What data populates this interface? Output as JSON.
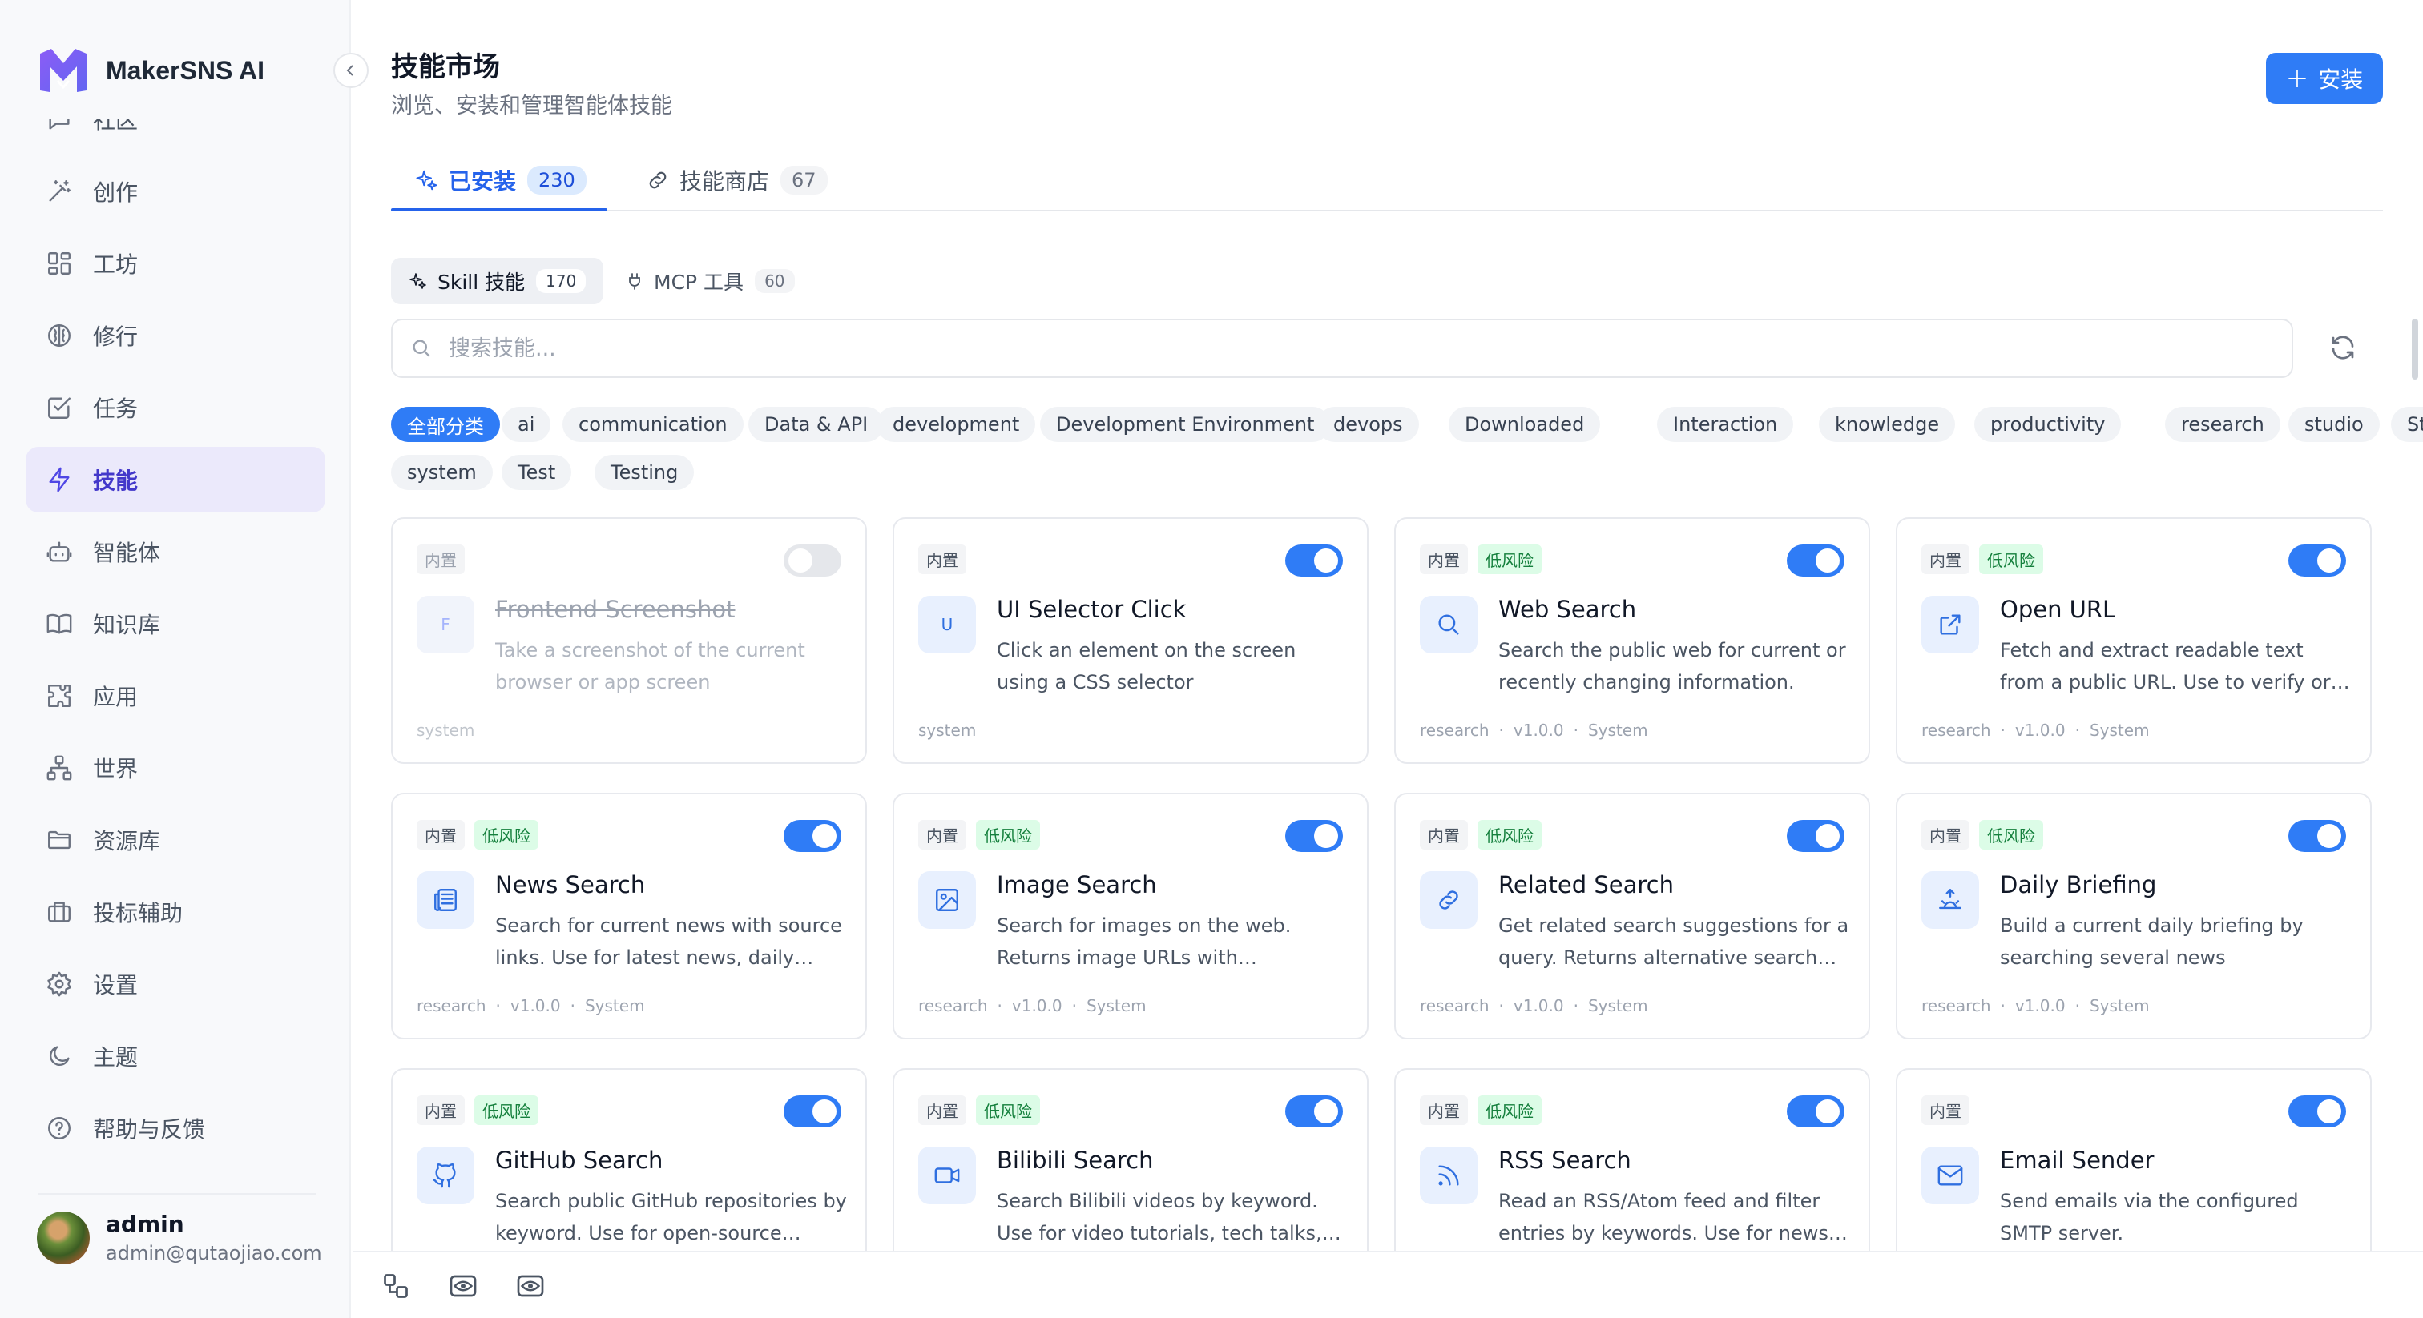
{
  "brand": {
    "name": "MakerSNS AI"
  },
  "sidebar": {
    "items": [
      {
        "label": "社区",
        "icon": "chat-icon"
      },
      {
        "label": "创作",
        "icon": "magic-wand-icon"
      },
      {
        "label": "工坊",
        "icon": "grid-icon"
      },
      {
        "label": "修行",
        "icon": "brain-icon"
      },
      {
        "label": "任务",
        "icon": "checkbox-icon"
      },
      {
        "label": "技能",
        "icon": "lightning-icon",
        "active": true
      },
      {
        "label": "智能体",
        "icon": "bot-icon"
      },
      {
        "label": "知识库",
        "icon": "book-icon"
      },
      {
        "label": "应用",
        "icon": "puzzle-icon"
      },
      {
        "label": "世界",
        "icon": "network-icon"
      },
      {
        "label": "资源库",
        "icon": "folder-icon"
      },
      {
        "label": "投标辅助",
        "icon": "briefcase-icon"
      },
      {
        "label": "设置",
        "icon": "gear-icon"
      },
      {
        "label": "主题",
        "icon": "moon-icon"
      },
      {
        "label": "帮助与反馈",
        "icon": "help-icon"
      }
    ],
    "user": {
      "name": "admin",
      "email": "admin@qutaojiao.com"
    }
  },
  "header": {
    "title": "技能市场",
    "subtitle": "浏览、安装和管理智能体技能",
    "install_label": "安装"
  },
  "tabs": [
    {
      "label": "已安装",
      "count": "230",
      "active": true
    },
    {
      "label": "技能商店",
      "count": "67",
      "active": false
    }
  ],
  "subtabs": [
    {
      "label": "Skill 技能",
      "count": "170",
      "active": true
    },
    {
      "label": "MCP 工具",
      "count": "60",
      "active": false
    }
  ],
  "search": {
    "placeholder": "搜索技能..."
  },
  "categories": [
    "全部分类",
    "ai",
    "communication",
    "Data & API",
    "development",
    "Development Environment",
    "devops",
    "Downloaded",
    "Interaction",
    "knowledge",
    "productivity",
    "research",
    "studio",
    "Studio",
    "system",
    "Test",
    "Testing"
  ],
  "labels": {
    "builtin": "内置",
    "low_risk": "低风险"
  },
  "skills": [
    {
      "title": "Frontend Screenshot",
      "desc": "Take a screenshot of the current browser or app screen",
      "category": "system",
      "version": "",
      "author": "",
      "enabled": false,
      "low_risk": false,
      "icon_letter": "F",
      "icon": "letter"
    },
    {
      "title": "UI Selector Click",
      "desc": "Click an element on the screen using a CSS selector",
      "category": "system",
      "version": "",
      "author": "",
      "enabled": true,
      "low_risk": false,
      "icon_letter": "U",
      "icon": "letter"
    },
    {
      "title": "Web Search",
      "desc": "Search the public web for current or recently changing information. Use…",
      "category": "research",
      "version": "v1.0.0",
      "author": "System",
      "enabled": true,
      "low_risk": true,
      "icon": "search-icon"
    },
    {
      "title": "Open URL",
      "desc": "Fetch and extract readable text from a public URL. Use to verify or…",
      "category": "research",
      "version": "v1.0.0",
      "author": "System",
      "enabled": true,
      "low_risk": true,
      "icon": "external-link-icon"
    },
    {
      "title": "News Search",
      "desc": "Search for current news with source links. Use for latest news, daily…",
      "category": "research",
      "version": "v1.0.0",
      "author": "System",
      "enabled": true,
      "low_risk": true,
      "icon": "newspaper-icon"
    },
    {
      "title": "Image Search",
      "desc": "Search for images on the web. Returns image URLs with…",
      "category": "research",
      "version": "v1.0.0",
      "author": "System",
      "enabled": true,
      "low_risk": true,
      "icon": "image-icon"
    },
    {
      "title": "Related Search",
      "desc": "Get related search suggestions for a query. Returns alternative search…",
      "category": "research",
      "version": "v1.0.0",
      "author": "System",
      "enabled": true,
      "low_risk": true,
      "icon": "link-icon"
    },
    {
      "title": "Daily Briefing",
      "desc": "Build a current daily briefing by searching several news categories.…",
      "category": "research",
      "version": "v1.0.0",
      "author": "System",
      "enabled": true,
      "low_risk": true,
      "icon": "sunrise-icon"
    },
    {
      "title": "GitHub Search",
      "desc": "Search public GitHub repositories by keyword. Use for open-source…",
      "category": "",
      "version": "",
      "author": "",
      "enabled": true,
      "low_risk": true,
      "icon": "github-icon"
    },
    {
      "title": "Bilibili Search",
      "desc": "Search Bilibili videos by keyword. Use for video tutorials, tech talks,…",
      "category": "",
      "version": "",
      "author": "",
      "enabled": true,
      "low_risk": true,
      "icon": "video-icon"
    },
    {
      "title": "RSS Search",
      "desc": "Read an RSS/Atom feed and filter entries by keywords. Use for news…",
      "category": "",
      "version": "",
      "author": "",
      "enabled": true,
      "low_risk": true,
      "icon": "rss-icon"
    },
    {
      "title": "Email Sender",
      "desc": "Send emails via the configured SMTP server.",
      "category": "",
      "version": "",
      "author": "",
      "enabled": true,
      "low_risk": false,
      "icon": "mail-icon"
    }
  ],
  "bottombar": {
    "icons": [
      "flow-icon",
      "eye-icon",
      "eye-scan-icon"
    ]
  },
  "colors": {
    "accent": "#2f7cf6",
    "active_nav_bg": "#ebe9fb",
    "risk_bg": "#dcfce7",
    "risk_text": "#15803d"
  }
}
